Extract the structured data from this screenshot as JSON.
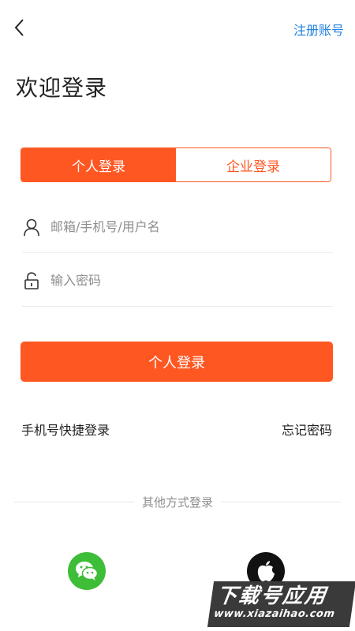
{
  "header": {
    "back_icon": "chevron-left-icon",
    "register_label": "注册账号"
  },
  "title": "欢迎登录",
  "tabs": [
    {
      "label": "个人登录",
      "active": true
    },
    {
      "label": "企业登录",
      "active": false
    }
  ],
  "form": {
    "username_placeholder": "邮箱/手机号/用户名",
    "username_icon": "user-icon",
    "password_placeholder": "输入密码",
    "password_icon": "lock-icon",
    "submit_label": "个人登录"
  },
  "links": {
    "quick_login": "手机号快捷登录",
    "forgot_password": "忘记密码"
  },
  "other_login": {
    "label": "其他方式登录",
    "providers": [
      {
        "name": "wechat",
        "icon": "wechat-icon",
        "color": "#3ebd39"
      },
      {
        "name": "apple",
        "icon": "apple-icon",
        "color": "#111111"
      }
    ]
  },
  "watermark": {
    "text": "下载号应用",
    "url": "www.xiazaihao.com"
  },
  "colors": {
    "accent": "#ff5722",
    "link": "#1f7fe0"
  }
}
